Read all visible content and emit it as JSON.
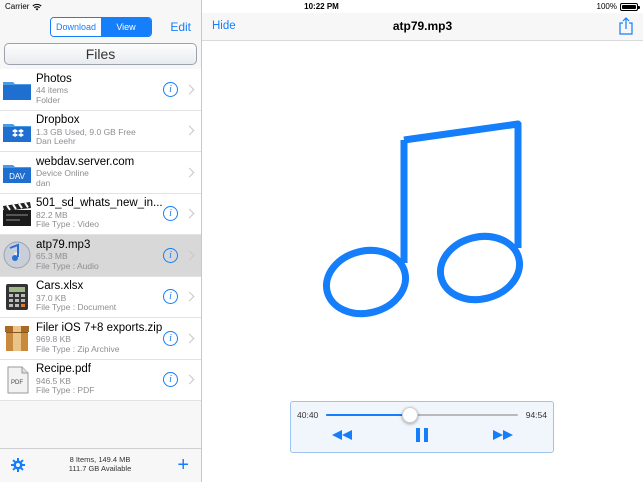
{
  "status_bar": {
    "carrier": "Carrier",
    "time": "10:22 PM",
    "battery": "100%",
    "battery_level": 1.0
  },
  "left_nav": {
    "segments": [
      "Download",
      "View"
    ],
    "selected_segment": "View",
    "edit_label": "Edit"
  },
  "files_header": "Files",
  "files": [
    {
      "name": "Photos",
      "line1": "44 items",
      "line2": "Folder",
      "icon": "folder-icon",
      "info": true,
      "selected": false
    },
    {
      "name": "Dropbox",
      "line1": "1.3 GB Used, 9.0 GB Free",
      "line2": "Dan Leehr",
      "icon": "dropbox-folder-icon",
      "info": false,
      "selected": false
    },
    {
      "name": "webdav.server.com",
      "line1": "Device Online",
      "line2": "dan",
      "icon": "dav-folder-icon",
      "info": false,
      "selected": false
    },
    {
      "name": "501_sd_whats_new_in...",
      "line1": "82.2 MB",
      "line2": "File Type : Video",
      "icon": "clapperboard-icon",
      "info": true,
      "selected": false
    },
    {
      "name": "atp79.mp3",
      "line1": "65.3 MB",
      "line2": "File Type : Audio",
      "icon": "music-cd-icon",
      "info": true,
      "selected": true
    },
    {
      "name": "Cars.xlsx",
      "line1": "37.0 KB",
      "line2": "File Type : Document",
      "icon": "calculator-icon",
      "info": true,
      "selected": false
    },
    {
      "name": "Filer iOS 7+8 exports.zip",
      "line1": "969.8 KB",
      "line2": "File Type : Zip Archive",
      "icon": "archive-box-icon",
      "info": true,
      "selected": false
    },
    {
      "name": "Recipe.pdf",
      "line1": "946.5 KB",
      "line2": "File Type : PDF",
      "icon": "pdf-file-icon",
      "info": true,
      "selected": false
    }
  ],
  "icon_labels": {
    "dav": "DAV",
    "pdf": "PDF"
  },
  "left_toolbar": {
    "summary_line1": "8 Items, 149.4 MB",
    "summary_line2": "111.7 GB Available"
  },
  "right_nav": {
    "hide_label": "Hide",
    "title": "atp79.mp3"
  },
  "player": {
    "elapsed": "40:40",
    "total": "94:54",
    "progress": 0.44
  },
  "colors": {
    "accent": "#157efb",
    "selected_row": "#d8d8d8"
  }
}
